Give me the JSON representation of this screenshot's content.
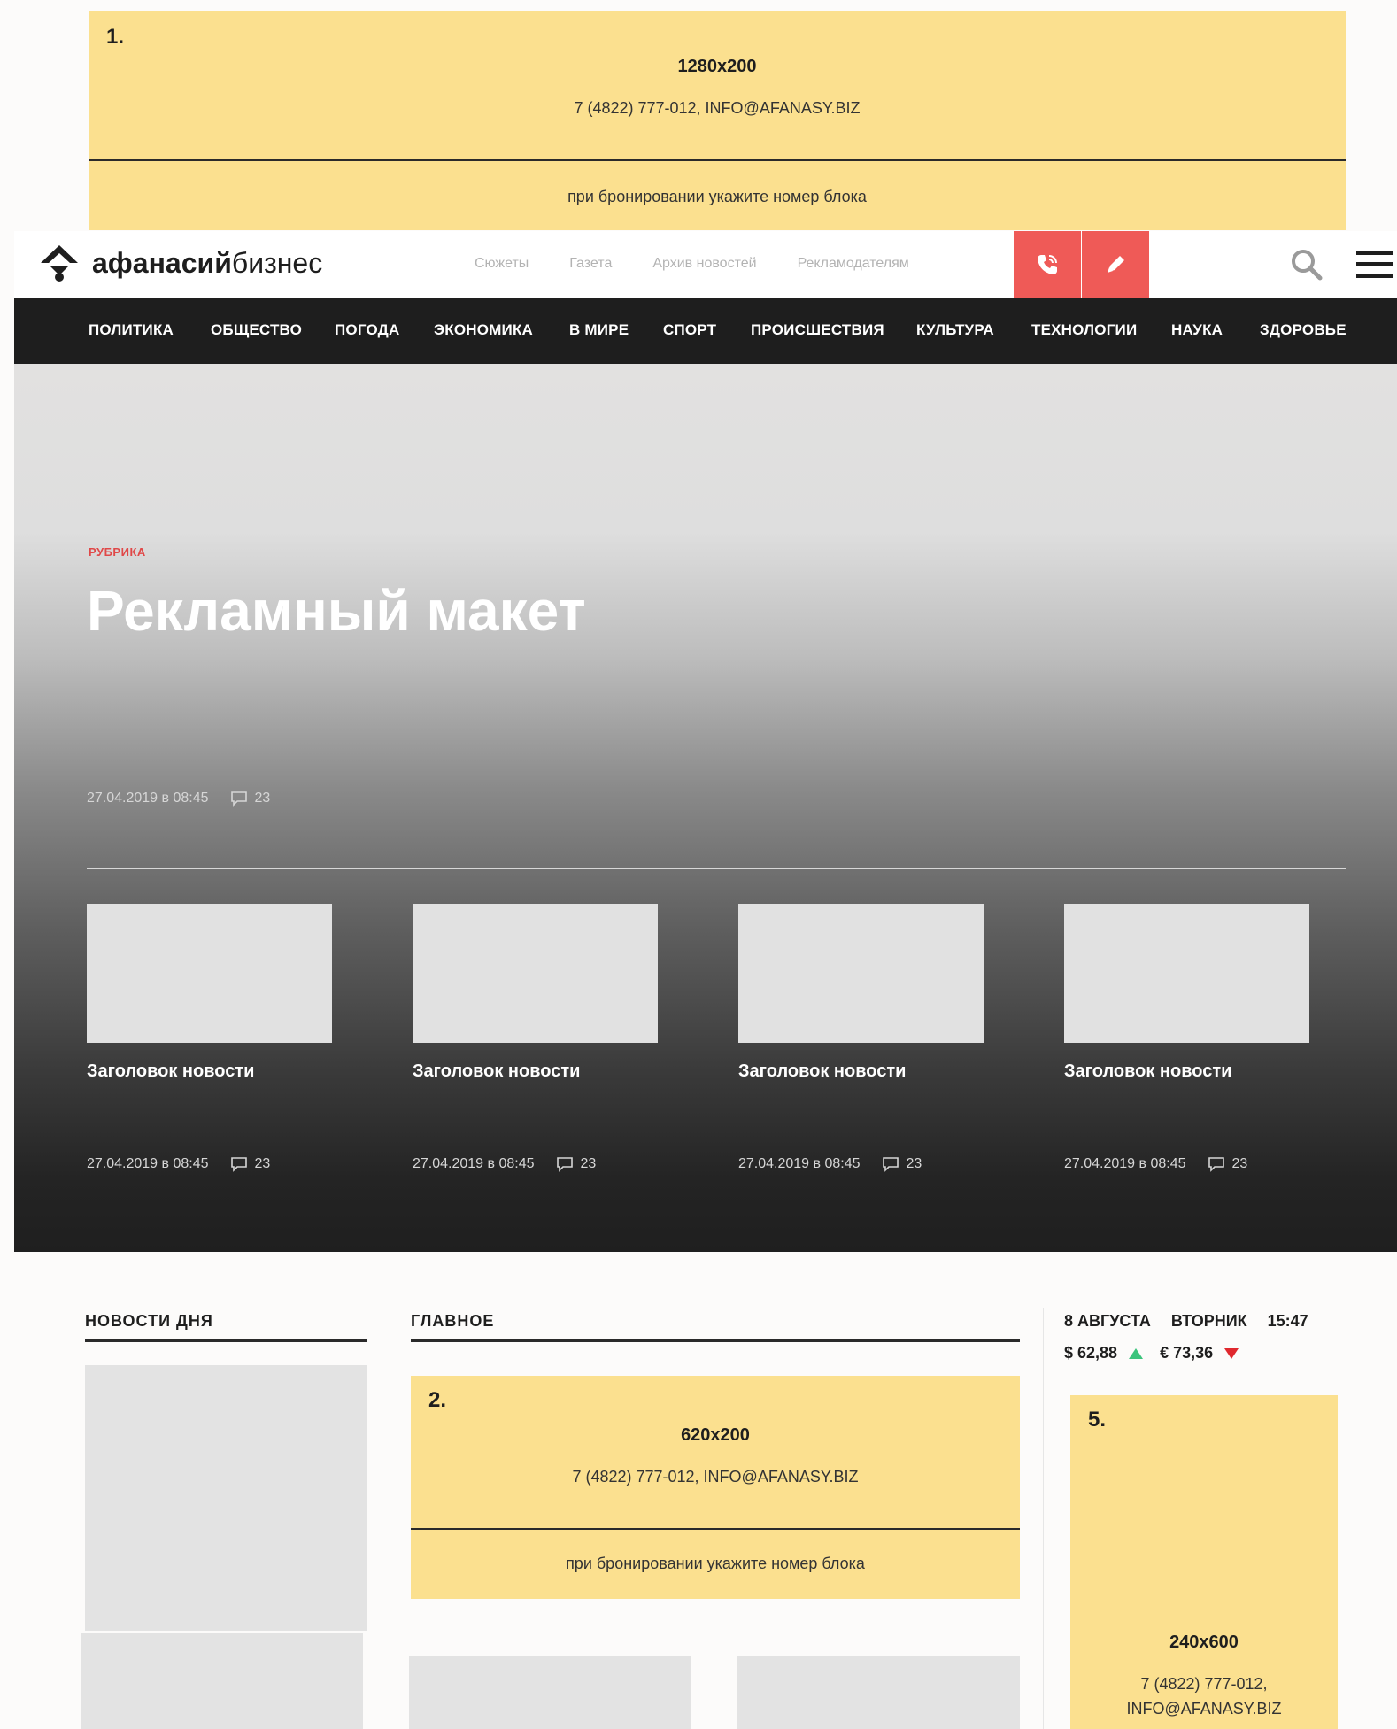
{
  "top_ad": {
    "number": "1.",
    "size": "1280x200",
    "contact": "7 (4822) 777-012, INFO@AFANASY.BIZ",
    "note": "при бронировании укажите номер блока"
  },
  "header": {
    "logo": {
      "bold": "афанасий",
      "regular": "бизнес"
    },
    "links": [
      "Сюжеты",
      "Газета",
      "Архив новостей",
      "Рекламодателям"
    ]
  },
  "main_nav": [
    "ПОЛИТИКА",
    "ОБЩЕСТВО",
    "ПОГОДА",
    "ЭКОНОМИКА",
    "В МИРЕ",
    "СПОРТ",
    "ПРОИСШЕСТВИЯ",
    "КУЛЬТУРА",
    "ТЕХНОЛОГИИ",
    "НАУКА",
    "ЗДОРОВЬЕ"
  ],
  "hero": {
    "rubric": "РУБРИКА",
    "title": "Рекламный макет",
    "date": "27.04.2019 в 08:45",
    "comments": "23"
  },
  "cards": [
    {
      "title": "Заголовок новости",
      "date": "27.04.2019 в 08:45",
      "comments": "23"
    },
    {
      "title": "Заголовок новости",
      "date": "27.04.2019 в 08:45",
      "comments": "23"
    },
    {
      "title": "Заголовок новости",
      "date": "27.04.2019 в 08:45",
      "comments": "23"
    },
    {
      "title": "Заголовок новости",
      "date": "27.04.2019 в 08:45",
      "comments": "23"
    }
  ],
  "sections": {
    "news_of_day": "НОВОСТИ ДНЯ",
    "main": "ГЛАВНОЕ"
  },
  "widget": {
    "date": "8 АВГУСТА",
    "weekday": "ВТОРНИК",
    "time": "15:47",
    "usd": "$ 62,88",
    "eur": "€ 73,36"
  },
  "ad2": {
    "number": "2.",
    "size": "620x200",
    "contact": "7 (4822) 777-012, INFO@AFANASY.BIZ",
    "note": "при бронировании укажите номер блока"
  },
  "ad5": {
    "number": "5.",
    "size": "240x600",
    "contact_line1": "7 (4822) 777-012,",
    "contact_line2": "INFO@AFANASY.BIZ"
  },
  "colors": {
    "accent_red": "#ef5a57",
    "ad_yellow": "#fbe08f",
    "nav_dark": "#1e1e1e",
    "rubric_red": "#e04848",
    "up_green": "#3cc47c",
    "down_red": "#e0282e"
  }
}
